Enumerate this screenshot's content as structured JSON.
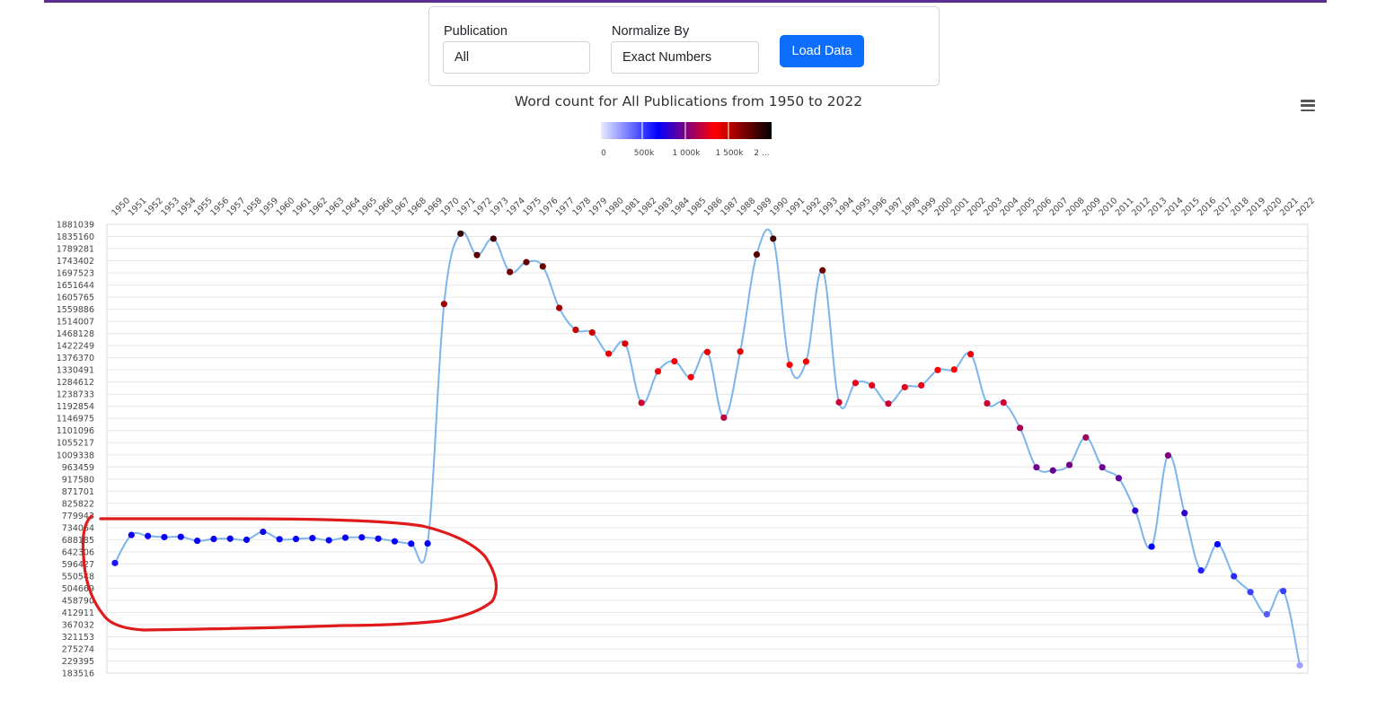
{
  "controls": {
    "publication_label": "Publication",
    "publication_value": "All",
    "normalize_label": "Normalize By",
    "normalize_value": "Exact Numbers",
    "load_button": "Load Data"
  },
  "chart_data": {
    "type": "line",
    "title": "Word count for All Publications from 1950 to 2022",
    "x": [
      1950,
      1951,
      1952,
      1953,
      1954,
      1955,
      1956,
      1957,
      1958,
      1959,
      1960,
      1961,
      1962,
      1963,
      1964,
      1965,
      1966,
      1967,
      1968,
      1969,
      1970,
      1971,
      1972,
      1973,
      1974,
      1975,
      1976,
      1977,
      1978,
      1979,
      1980,
      1981,
      1982,
      1983,
      1984,
      1985,
      1986,
      1987,
      1988,
      1989,
      1990,
      1991,
      1992,
      1993,
      1994,
      1995,
      1996,
      1997,
      1998,
      1999,
      2000,
      2001,
      2002,
      2003,
      2004,
      2005,
      2006,
      2007,
      2008,
      2009,
      2010,
      2011,
      2012,
      2013,
      2014,
      2015,
      2016,
      2017,
      2018,
      2019,
      2020,
      2021,
      2022
    ],
    "series": [
      {
        "values": [
          600000,
          706000,
          702000,
          698000,
          699000,
          684000,
          691000,
          692000,
          688000,
          718000,
          690000,
          691000,
          694000,
          686000,
          696000,
          697000,
          692000,
          682000,
          673000,
          674000,
          1580000,
          1846000,
          1765000,
          1827000,
          1701000,
          1738000,
          1722000,
          1565000,
          1482000,
          1472000,
          1392000,
          1430000,
          1206000,
          1325000,
          1363000,
          1303000,
          1398000,
          1150000,
          1400000,
          1767000,
          1827000,
          1350000,
          1362000,
          1707000,
          1208000,
          1281000,
          1272000,
          1203000,
          1265000,
          1272000,
          1330000,
          1332000,
          1390000,
          1204000,
          1207000,
          1111000,
          962000,
          950000,
          971000,
          1075000,
          962000,
          921000,
          798000,
          662000,
          1007000,
          789000,
          572000,
          671000,
          550000,
          490000,
          406000,
          494000,
          213000
        ]
      }
    ],
    "ylim": [
      183516,
      1881039
    ],
    "y_ticks": [
      "1881039",
      "1835160",
      "1789281",
      "1743402",
      "1697523",
      "1651644",
      "1605765",
      "1559886",
      "1514007",
      "1468128",
      "1422249",
      "1376370",
      "1330491",
      "1284612",
      "1238733",
      "1192854",
      "1146975",
      "1101096",
      "1055217",
      "1009338",
      "963459",
      "917580",
      "871701",
      "825822",
      "779943",
      "734064",
      "688185",
      "642306",
      "596427",
      "550548",
      "504669",
      "458790",
      "412911",
      "367032",
      "321153",
      "275274",
      "229395",
      "183516"
    ],
    "colorbar": {
      "ticks": [
        "0",
        "500k",
        "1 000k",
        "1 500k",
        "2 ..."
      ],
      "max": 2000000,
      "stops": [
        "#e6ebff",
        "#0000ff",
        "#ff0000",
        "#000000"
      ]
    },
    "line_color": "#7cb5ec",
    "annotation_color": "#e01b1b",
    "grid": true
  }
}
